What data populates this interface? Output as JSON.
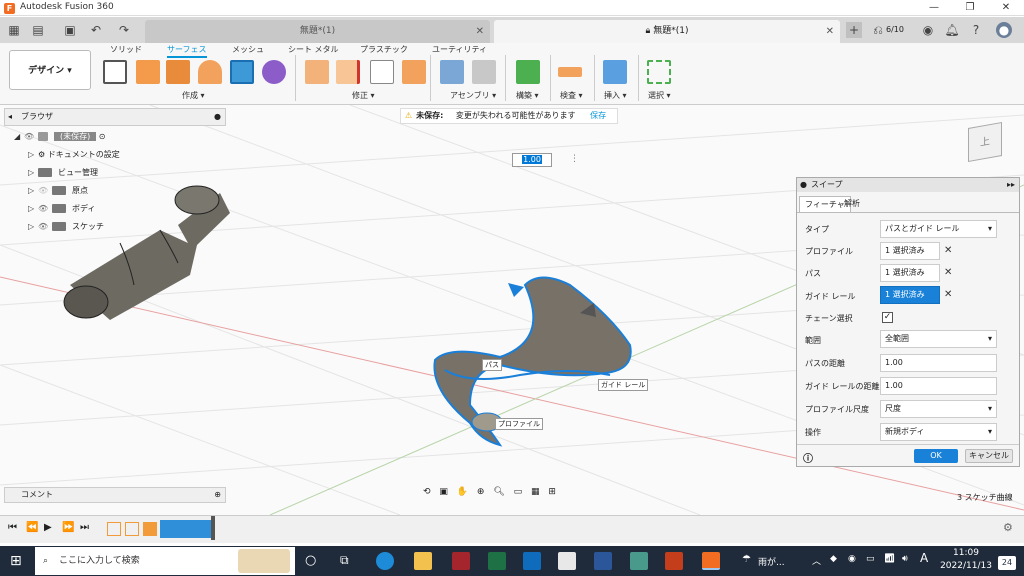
{
  "window": {
    "title": "Autodesk Fusion 360"
  },
  "tabs": [
    {
      "label": "無題*(1)"
    },
    {
      "label": "無題*(1)"
    }
  ],
  "tab_counter": "6/10",
  "workspace": {
    "label": "デザイン ▾"
  },
  "ribbon_tabs": [
    "ソリッド",
    "サーフェス",
    "メッシュ",
    "シート メタル",
    "プラスチック",
    "ユーティリティ"
  ],
  "groups": {
    "create": "作成 ▾",
    "modify": "修正 ▾",
    "assemble": "アセンブリ ▾",
    "construct": "構築 ▾",
    "inspect": "検査 ▾",
    "insert": "挿入 ▾",
    "select": "選択 ▾"
  },
  "browser": {
    "title": "ブラウザ",
    "items": [
      "(未保存)",
      "ドキュメントの設定",
      "ビュー管理",
      "原点",
      "ボディ",
      "スケッチ"
    ]
  },
  "banner": {
    "status": "未保存:",
    "message": "変更が失われる可能性があります",
    "save": "保存"
  },
  "value_input": "1.00",
  "sweep": {
    "title": "スイープ",
    "tabs": [
      "フィーチャ",
      "解析"
    ],
    "rows": [
      {
        "label": "タイプ",
        "value": "パスとガイド レール"
      },
      {
        "label": "プロファイル",
        "value": "1 選択済み"
      },
      {
        "label": "パス",
        "value": "1 選択済み"
      },
      {
        "label": "ガイド レール",
        "value": "1 選択済み"
      },
      {
        "label": "チェーン選択",
        "value": ""
      },
      {
        "label": "範囲",
        "value": "全範囲"
      },
      {
        "label": "パスの距離",
        "value": "1.00"
      },
      {
        "label": "ガイド レールの距離",
        "value": "1.00"
      },
      {
        "label": "プロファイル尺度",
        "value": "尺度"
      },
      {
        "label": "操作",
        "value": "新規ボディ"
      }
    ],
    "ok": "OK",
    "cancel": "キャンセル"
  },
  "labels3d": {
    "path": "パス",
    "rail": "ガイド レール",
    "profile": "プロファイル"
  },
  "comment": "コメント",
  "status_right": "3 スケッチ曲線",
  "taskbar": {
    "search": "ここに入力して検索",
    "weather": "雨が...",
    "ime": "A",
    "time": "11:09",
    "date": "2022/11/13",
    "notify": "24"
  }
}
